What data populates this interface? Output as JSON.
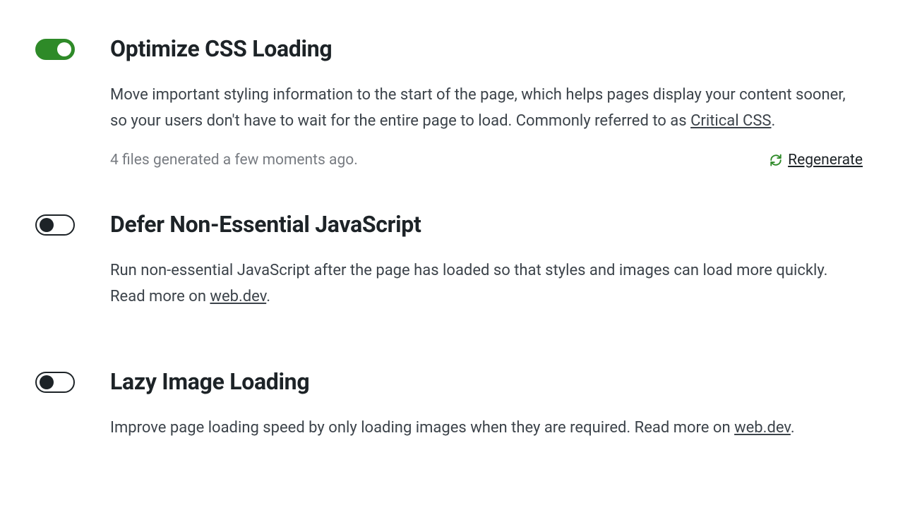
{
  "settings": [
    {
      "id": "optimize-css",
      "title": "Optimize CSS Loading",
      "enabled": true,
      "desc_pre": "Move important styling information to the start of the page, which helps pages display your content sooner, so your users don't have to wait for the entire page to load. Commonly referred to as ",
      "desc_link": "Critical CSS",
      "desc_post": ".",
      "status": "4 files generated a few moments ago.",
      "regenerate_label": "Regenerate"
    },
    {
      "id": "defer-js",
      "title": "Defer Non-Essential JavaScript",
      "enabled": false,
      "desc_pre": "Run non-essential JavaScript after the page has loaded so that styles and images can load more quickly. Read more on ",
      "desc_link": "web.dev",
      "desc_post": "."
    },
    {
      "id": "lazy-images",
      "title": "Lazy Image Loading",
      "enabled": false,
      "desc_pre": "Improve page loading speed by only loading images when they are required. Read more on ",
      "desc_link": "web.dev",
      "desc_post": "."
    }
  ]
}
